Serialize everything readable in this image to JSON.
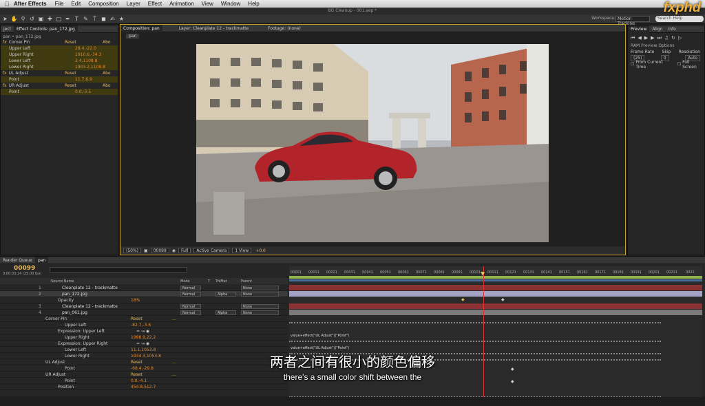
{
  "menubar": {
    "app": "After Effects",
    "items": [
      "File",
      "Edit",
      "Composition",
      "Layer",
      "Effect",
      "Animation",
      "View",
      "Window",
      "Help"
    ]
  },
  "window_title": "BG Cleanup - 001.aep *",
  "workspace": {
    "label": "Workspace:",
    "value": "Motion Tracking"
  },
  "search_placeholder": "Search Help",
  "logo_text": "fxphd",
  "effect_controls": {
    "tab_project": "ject",
    "tab_label": "Effect Controls: pan_172.jpg",
    "subtitle": "pan • pan_172.jpg",
    "rows": [
      {
        "label": "Corner Pin",
        "kind": "fx",
        "reset": "Reset",
        "about": "Abo"
      },
      {
        "label": "Upper Left",
        "value": "28.4,-22.0"
      },
      {
        "label": "Upper Right",
        "value": "1910.6,-34.3"
      },
      {
        "label": "Lower Left",
        "value": "3.4,1108.8"
      },
      {
        "label": "Lower Right",
        "value": "1903.2,1108.8"
      },
      {
        "label": "UL Adjust",
        "kind": "fx",
        "reset": "Reset",
        "about": "Abo"
      },
      {
        "label": "Point",
        "value": "11.7,6.9"
      },
      {
        "label": "UR Adjust",
        "kind": "fx",
        "reset": "Reset",
        "about": "Abo"
      },
      {
        "label": "Point",
        "value": "0.0,-5.5"
      }
    ]
  },
  "viewer": {
    "tab_comp": "Composition: pan",
    "tab_layer": "Layer: Cleanplate 12 - trackmatte",
    "tab_footage": "Footage: (none)",
    "comp_label": "pan",
    "zoom": "(50%)",
    "frame": "00099",
    "resolution": "Full",
    "camera": "Active Camera",
    "views": "1 View",
    "exposure": "+0.0"
  },
  "preview": {
    "tab_preview": "Preview",
    "tab_align": "Align",
    "tab_info": "Info",
    "ram_options": "RAM Preview Options",
    "frame_rate_label": "Frame Rate",
    "skip_label": "Skip",
    "resolution_label": "Resolution",
    "frame_rate": "(25)",
    "skip": "0",
    "resolution": "Auto",
    "from_current": "From Current Time",
    "full_screen": "Full Screen"
  },
  "timeline": {
    "tab_render": "Render Queue",
    "tab_comp": "pan",
    "timecode": "00099",
    "timecode_sub": "0:00:03:24 (25.00 fps)",
    "headers": {
      "source": "Source Name",
      "mode": "Mode",
      "t": "T",
      "trkmat": "TrkMat",
      "parent": "Parent"
    },
    "ruler_ticks": [
      "00001",
      "00011",
      "00021",
      "00031",
      "00041",
      "00051",
      "00061",
      "00071",
      "00081",
      "00091",
      "00101",
      "00111",
      "00121",
      "00131",
      "00141",
      "00151",
      "00161",
      "00171",
      "00181",
      "00191",
      "00201",
      "00211",
      "0022"
    ],
    "layers": [
      {
        "num": "1",
        "name": "Cleanplate 12 - trackmatte",
        "mode": "Normal",
        "trkmat": "",
        "parent": "None"
      },
      {
        "num": "2",
        "name": "pan_172.jpg",
        "mode": "Normal",
        "trkmat": "Alpha",
        "parent": "None"
      },
      {
        "label": "Opacity",
        "value": "18%"
      },
      {
        "num": "3",
        "name": "Cleanplate 12 - trackmatte",
        "mode": "Normal",
        "trkmat": "",
        "parent": "None"
      },
      {
        "num": "4",
        "name": "pan_061.jpg",
        "mode": "Normal",
        "trkmat": "Alpha",
        "parent": "None"
      },
      {
        "label": "Corner Pin",
        "reset": "Reset",
        "dots": "..."
      },
      {
        "label": "Upper Left",
        "value": "-82.7,-3.6"
      },
      {
        "label": "Expression: Upper Left"
      },
      {
        "label": "Upper Right",
        "value": "1988.9,22.2"
      },
      {
        "label": "Expression: Upper Right"
      },
      {
        "label": "Lower Left",
        "value": "11.1,1053.8"
      },
      {
        "label": "Lower Right",
        "value": "1934.3,1053.8"
      },
      {
        "label": "UL Adjust",
        "reset": "Reset",
        "dots": "..."
      },
      {
        "label": "Point",
        "value": "-68.4,-29.8"
      },
      {
        "label": "UR Adjust",
        "reset": "Reset",
        "dots": "..."
      },
      {
        "label": "Point",
        "value": "0.0,-4.1"
      },
      {
        "label": "Position",
        "value": "454.8,512.7"
      }
    ],
    "expr_ul": "value+effect(\"UL Adjust\")(\"Point\")",
    "expr_ur": "value+effect(\"UL Adjust\")(\"Point\")"
  },
  "subtitles": {
    "zh": "两者之间有很小的颜色偏移",
    "en": "there's a small color shift between the"
  },
  "colors": {
    "accent": "#e38a2d",
    "highlight": "#e6b85c",
    "viewer_border": "#c2a02a",
    "layer_red": "#8a3232",
    "layer_lilac": "#a4a2c4",
    "layer_gray": "#7a7a7a"
  }
}
